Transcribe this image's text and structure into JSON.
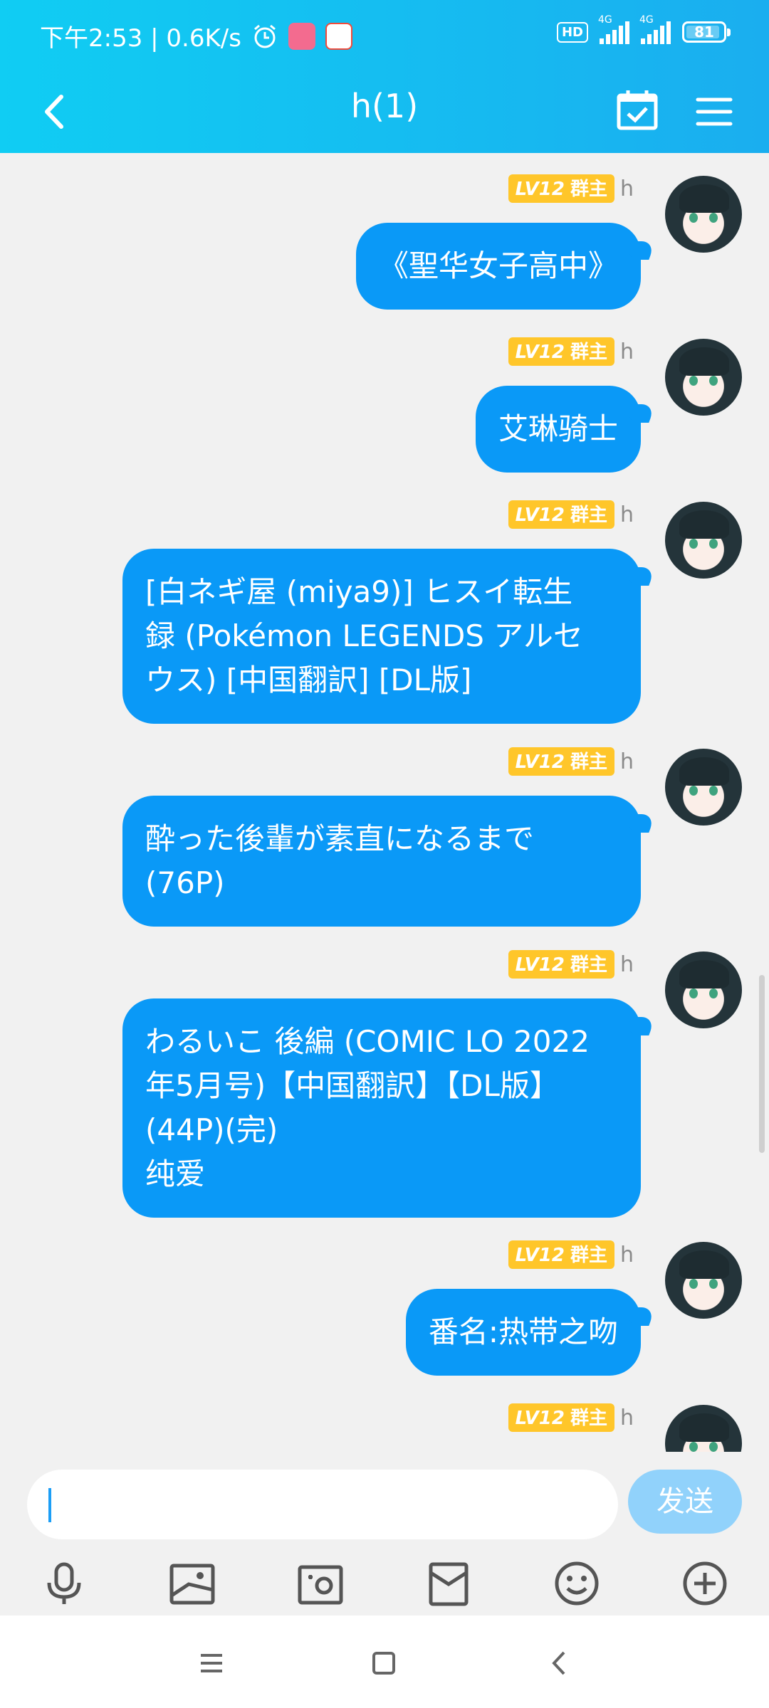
{
  "status_bar": {
    "time_speed": "下午2:53 | 0.6K/s",
    "hd": "HD",
    "net1": "4G",
    "net2": "4G",
    "battery": "81"
  },
  "header": {
    "title": "h(1)"
  },
  "messages": [
    {
      "badge_level": "LV12",
      "badge_role": "群主",
      "username": "h",
      "text": "《聖华女子高中》"
    },
    {
      "badge_level": "LV12",
      "badge_role": "群主",
      "username": "h",
      "text": "艾琳骑士"
    },
    {
      "badge_level": "LV12",
      "badge_role": "群主",
      "username": "h",
      "text": "[白ネギ屋 (miya9)] ヒスイ転生\n録 (Pokémon LEGENDS アルセ\nウス) [中国翻訳] [DL版]"
    },
    {
      "badge_level": "LV12",
      "badge_role": "群主",
      "username": "h",
      "text": "酔った後輩が素直になるまで\n(76P)"
    },
    {
      "badge_level": "LV12",
      "badge_role": "群主",
      "username": "h",
      "text": "わるいこ 後編 (COMIC LO 2022\n年5月号)【中国翻訳】【DL版】\n(44P)(完)\n纯爱"
    },
    {
      "badge_level": "LV12",
      "badge_role": "群主",
      "username": "h",
      "text": "番名:热带之吻"
    },
    {
      "badge_level": "LV12",
      "badge_role": "群主",
      "username": "h",
      "text": ""
    }
  ],
  "composer": {
    "input_value": "",
    "send_label": "发送"
  },
  "colors": {
    "header": "#1bb8f1",
    "bubble": "#0a99f7",
    "badge": "#ffc62a",
    "send": "#91d2fb"
  }
}
